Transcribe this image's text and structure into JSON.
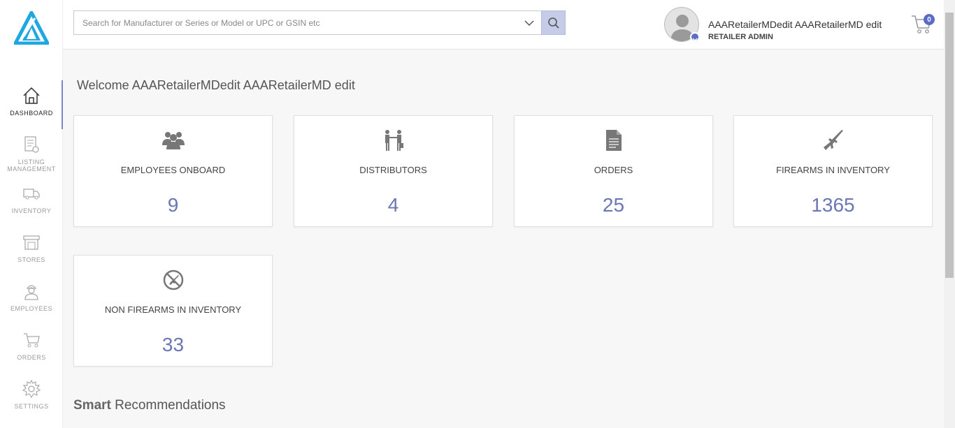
{
  "sidebar": {
    "items": [
      {
        "label": "DASHBOARD",
        "icon": "home-icon",
        "active": true
      },
      {
        "label": "LISTING MANAGEMENT",
        "icon": "listing-icon"
      },
      {
        "label": "INVENTORY",
        "icon": "truck-icon"
      },
      {
        "label": "STORES",
        "icon": "store-icon"
      },
      {
        "label": "EMPLOYEES",
        "icon": "employee-icon"
      },
      {
        "label": "ORDERS",
        "icon": "cart-icon"
      },
      {
        "label": "SETTINGS",
        "icon": "gear-icon"
      }
    ]
  },
  "header": {
    "search_placeholder": "Search for Manufacturer or Series or Model or UPC or GSIN etc",
    "user_name": "AAARetailerMDedit AAARetailerMD edit",
    "user_role": "RETAILER ADMIN",
    "cart_count": "0"
  },
  "main": {
    "welcome": "Welcome AAARetailerMDedit AAARetailerMD edit",
    "cards": [
      {
        "title": "EMPLOYEES ONBOARD",
        "value": "9",
        "icon": "users-icon"
      },
      {
        "title": "DISTRIBUTORS",
        "value": "4",
        "icon": "handshake-icon"
      },
      {
        "title": "ORDERS",
        "value": "25",
        "icon": "document-icon"
      },
      {
        "title": "FIREARMS IN INVENTORY",
        "value": "1365",
        "icon": "rifle-icon"
      },
      {
        "title": "NON FIREARMS IN INVENTORY",
        "value": "33",
        "icon": "no-firearm-icon"
      }
    ],
    "section_bold": "Smart",
    "section_rest": " Recommendations"
  },
  "colors": {
    "accent": "#6b76b4",
    "badge": "#5b6cc7",
    "search_button": "#c5cce8"
  }
}
